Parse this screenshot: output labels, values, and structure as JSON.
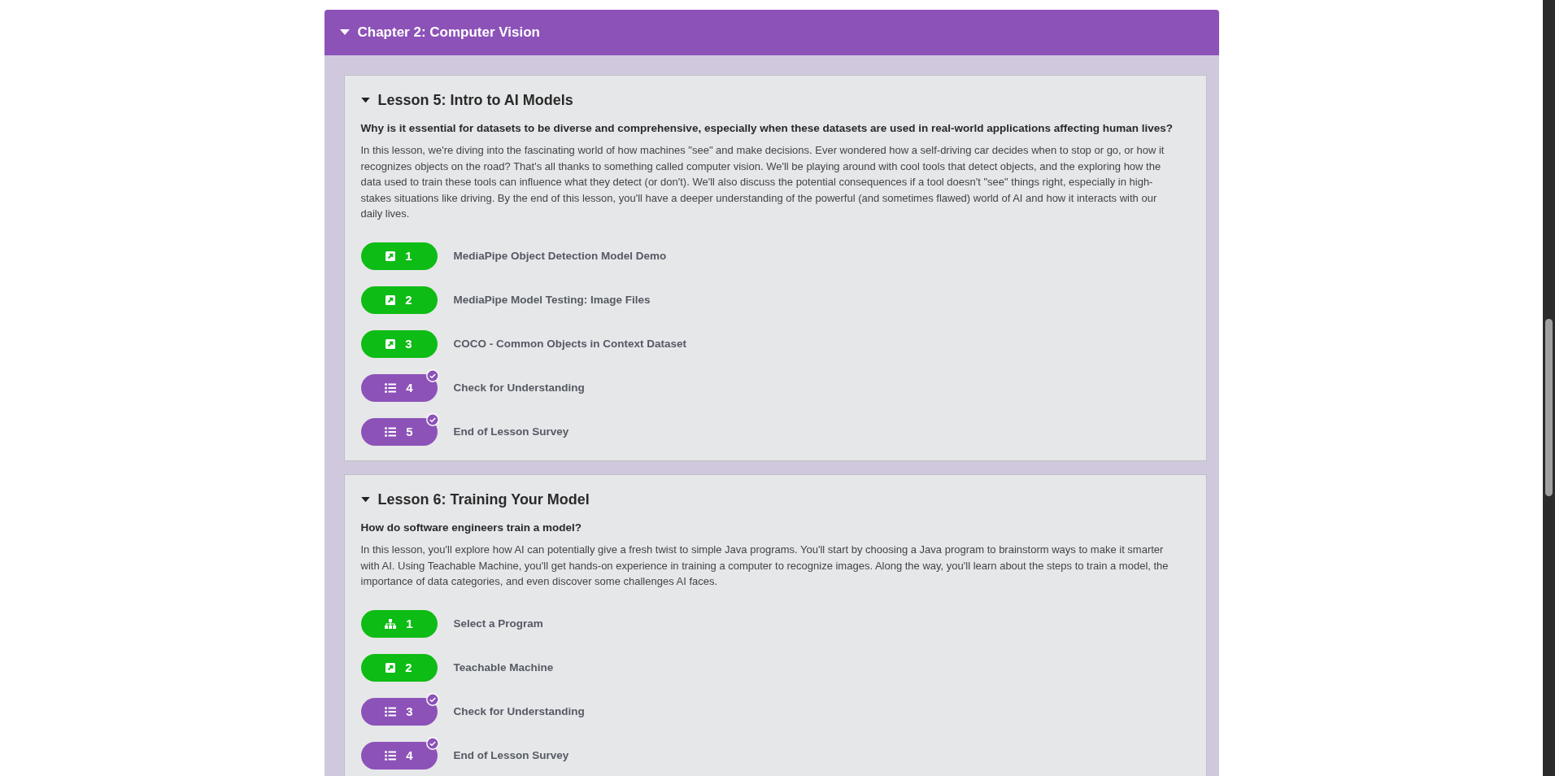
{
  "chapter": {
    "title": "Chapter 2: Computer Vision",
    "expanded": true,
    "lessons": [
      {
        "title": "Lesson 5: Intro to AI Models",
        "expanded": true,
        "question": "Why is it essential for datasets to be diverse and comprehensive, especially when these datasets are used in real-world applications affecting human lives?",
        "description": "In this lesson, we're diving into the fascinating world of how machines \"see\" and make decisions. Ever wondered how a self-driving car decides when to stop or go, or how it recognizes objects on the road? That's all thanks to something called computer vision. We'll be playing around with cool tools that detect objects, and the exploring how the data used to train these tools can influence what they detect (or don't). We'll also discuss the potential consequences if a tool doesn't \"see\" things right, especially in high-stakes situations like driving. By the end of this lesson, you'll have a deeper understanding of the powerful (and sometimes flawed) world of AI and how it interacts with our daily lives.",
        "activities": [
          {
            "kind": "link",
            "number": "1",
            "label": "MediaPipe Object Detection Model Demo",
            "completed": false
          },
          {
            "kind": "link",
            "number": "2",
            "label": "MediaPipe Model Testing: Image Files",
            "completed": false
          },
          {
            "kind": "link",
            "number": "3",
            "label": "COCO - Common Objects in Context Dataset",
            "completed": false
          },
          {
            "kind": "quiz",
            "number": "4",
            "label": "Check for Understanding",
            "completed": true
          },
          {
            "kind": "quiz",
            "number": "5",
            "label": "End of Lesson Survey",
            "completed": true
          }
        ]
      },
      {
        "title": "Lesson 6: Training Your Model",
        "expanded": true,
        "question": "How do software engineers train a model?",
        "description": "In this lesson, you'll explore how AI can potentially give a fresh twist to simple Java programs. You'll start by choosing a Java program to brainstorm ways to make it smarter with AI. Using Teachable Machine, you'll get hands-on experience in training a computer to recognize images. Along the way, you'll learn about the steps to train a model, the importance of data categories, and even discover some challenges AI faces.",
        "activities": [
          {
            "kind": "program",
            "number": "1",
            "label": "Select a Program",
            "completed": false
          },
          {
            "kind": "link",
            "number": "2",
            "label": "Teachable Machine",
            "completed": false
          },
          {
            "kind": "quiz",
            "number": "3",
            "label": "Check for Understanding",
            "completed": true
          },
          {
            "kind": "quiz",
            "number": "4",
            "label": "End of Lesson Survey",
            "completed": true
          }
        ]
      }
    ]
  }
}
